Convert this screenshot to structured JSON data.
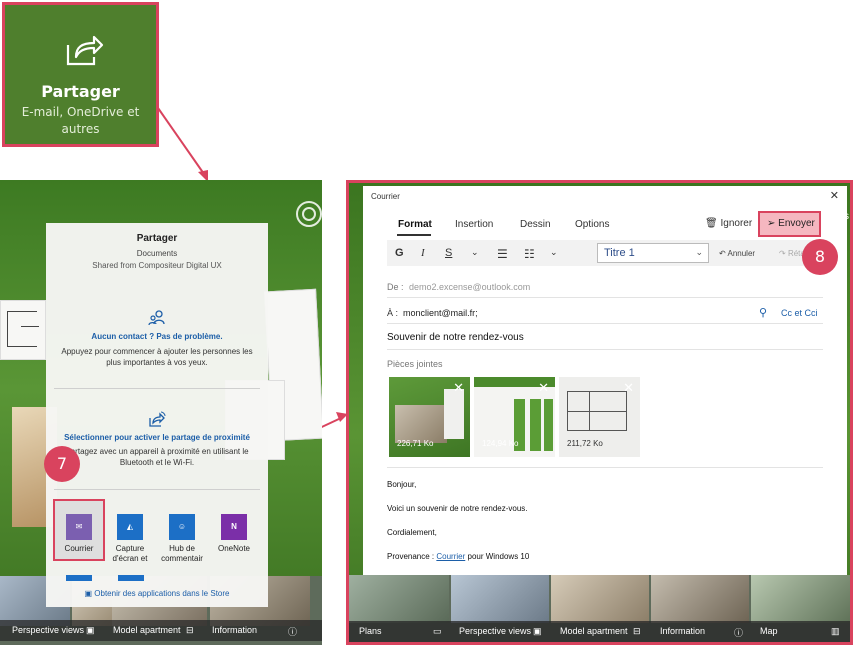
{
  "share_tile": {
    "title": "Partager",
    "subtitle": "E-mail, OneDrive et autres"
  },
  "flyout": {
    "title": "Partager",
    "subtitle_doc": "Documents",
    "subtitle_source": "Shared from Compositeur Digital UX",
    "contacts_title": "Aucun contact ? Pas de problème.",
    "contacts_text": "Appuyez pour commencer à ajouter les personnes les plus importantes à vos yeux.",
    "proximity_title": "Sélectionner pour activer le partage de proximité",
    "proximity_text": "Partagez avec un appareil à proximité en utilisant le Bluetooth et le Wi-Fi.",
    "apps": [
      {
        "label": "Courrier",
        "icon": "mail-icon",
        "color": "#7b5fb0"
      },
      {
        "label": "Capture d'écran et",
        "icon": "snip-icon",
        "color": "#1c6fc6"
      },
      {
        "label": "Hub de commentair",
        "icon": "feedback-icon",
        "color": "#1c6fc6"
      },
      {
        "label": "OneNote",
        "icon": "onenote-icon",
        "color": "#7b2fa8"
      }
    ],
    "store_link": "Obtenir des applications dans le Store"
  },
  "badges": {
    "step7": "7",
    "step8": "8"
  },
  "left_strip": {
    "labels": [
      "Perspective views",
      "Model apartment",
      "Information"
    ]
  },
  "mail": {
    "window_title": "Courrier",
    "tabs": [
      "Format",
      "Insertion",
      "Dessin",
      "Options"
    ],
    "ignore_label": "Ignorer",
    "send_label": "Envoyer",
    "format": {
      "bold": "G",
      "italic": "I",
      "underline": "S",
      "style": "Titre 1",
      "undo": "Annuler",
      "redo": "Rétablir"
    },
    "from_label": "De :",
    "from_value": "demo2.excense@outlook.com",
    "to_label": "À :",
    "to_value": "monclient@mail.fr;",
    "cc_label": "Cc et Cci",
    "subject": "Souvenir de notre rendez-vous",
    "attachments_label": "Pièces jointes",
    "attachments": [
      {
        "size": "226,71 Ko"
      },
      {
        "size": "124,94 Ko"
      },
      {
        "size": "211,72 Ko"
      }
    ],
    "body": {
      "greeting": "Bonjour,",
      "line1": "Voici un souvenir de notre rendez-vous.",
      "closing": "Cordialement,",
      "provenance_prefix": "Provenance : ",
      "provenance_link": "Courrier",
      "provenance_suffix": " pour Windows 10"
    }
  },
  "right_strip": {
    "labels": [
      "Plans",
      "Perspective views",
      "Model apartment",
      "Information",
      "Map"
    ]
  },
  "colors": {
    "highlight": "#d9435e",
    "tile_green": "#4f7f2d",
    "link_blue": "#1c5ea8"
  }
}
